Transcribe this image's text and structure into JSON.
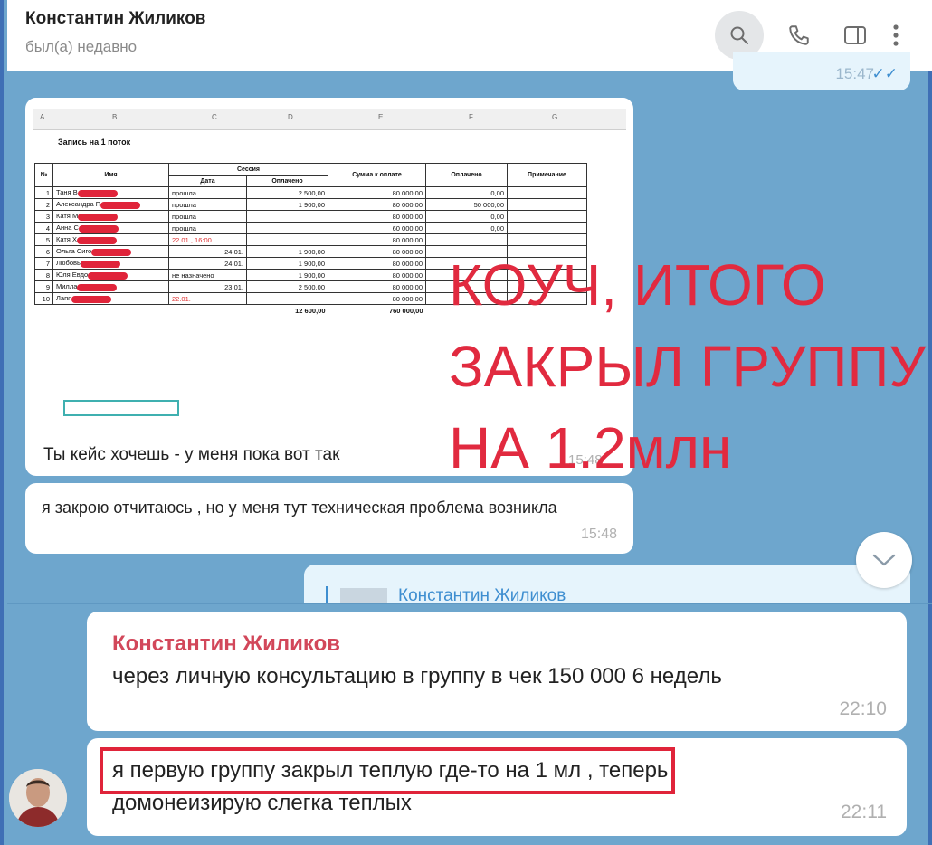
{
  "header": {
    "contact_name": "Константин Жиликов",
    "status": "был(а) недавно"
  },
  "top_outgoing": {
    "time": "15:47",
    "ticks": "✓✓"
  },
  "photo_message": {
    "sheet": {
      "column_letters": [
        "A",
        "B",
        "C",
        "D",
        "E",
        "F",
        "G"
      ],
      "title": "Запись на 1 поток",
      "headers": {
        "no": "№",
        "name": "Имя",
        "session": "Сессия",
        "date": "Дата",
        "paid_session": "Оплачено",
        "amount_due": "Сумма к оплате",
        "paid": "Оплачено",
        "note": "Примечание"
      },
      "rows": [
        {
          "n": "1",
          "name": "Таня В",
          "date": "прошла",
          "paid_s": "2 500,00",
          "due": "80 000,00",
          "paid": "0,00",
          "red": false
        },
        {
          "n": "2",
          "name": "Александра П",
          "date": "прошла",
          "paid_s": "1 900,00",
          "due": "80 000,00",
          "paid": "50 000,00",
          "red": false
        },
        {
          "n": "3",
          "name": "Катя М",
          "date": "прошла",
          "paid_s": "",
          "due": "80 000,00",
          "paid": "0,00",
          "red": false
        },
        {
          "n": "4",
          "name": "Анна С",
          "date": "прошла",
          "paid_s": "",
          "due": "60 000,00",
          "paid": "0,00",
          "red": false
        },
        {
          "n": "5",
          "name": "Катя Х",
          "date": "22.01., 16:00",
          "paid_s": "",
          "due": "80 000,00",
          "paid": "",
          "red": true
        },
        {
          "n": "6",
          "name": "Ольга Сиго",
          "date": "24.01.",
          "paid_s": "1 900,00",
          "due": "80 000,00",
          "paid": "",
          "red": false
        },
        {
          "n": "7",
          "name": "Любовь",
          "date": "24.01.",
          "paid_s": "1 900,00",
          "due": "80 000,00",
          "paid": "",
          "red": false
        },
        {
          "n": "8",
          "name": "Юля Евдо",
          "date": "не назначено",
          "paid_s": "1 900,00",
          "due": "80 000,00",
          "paid": "",
          "red": false
        },
        {
          "n": "9",
          "name": "Милла",
          "date": "23.01.",
          "paid_s": "2 500,00",
          "due": "80 000,00",
          "paid": "",
          "red": false
        },
        {
          "n": "10",
          "name": "Лапя",
          "date": "22.01.",
          "paid_s": "",
          "due": "80 000,00",
          "paid": "",
          "red": true
        }
      ],
      "totals": {
        "paid_session": "12 600,00",
        "amount_due": "760 000,00"
      }
    },
    "caption": "Ты кейс хочешь - у меня пока вот так",
    "time": "15:48"
  },
  "overlay_text": {
    "line1": "КОУЧ, ИТОГО",
    "line2": "ЗАКРЫЛ ГРУППУ",
    "line3": "НА 1.2млн"
  },
  "message2": {
    "text": "я закрою отчитаюсь , но у меня тут техническая проблема возникла",
    "time": "15:48"
  },
  "reply_preview": {
    "name": "Константин Жиликов"
  },
  "quoted_message": {
    "sender": "Константин Жиликов",
    "text": "через личную консультацию в группу в чек 150 000 6 недель",
    "time": "22:10"
  },
  "last_message": {
    "text": "я первую группу закрыл теплую  где-то на 1 мл , теперь домонеизирую  слегка теплых",
    "time": "22:11"
  },
  "icons": {
    "search": "search-icon",
    "call": "phone-icon",
    "panel": "sidebar-toggle-icon",
    "more": "more-vertical-icon",
    "scroll": "chevron-down-icon"
  },
  "colors": {
    "chat_background": "#6ea6cd",
    "overlay_red": "#e12a3f",
    "sender_name": "#d2475a",
    "link_blue": "#3e8ed0"
  }
}
